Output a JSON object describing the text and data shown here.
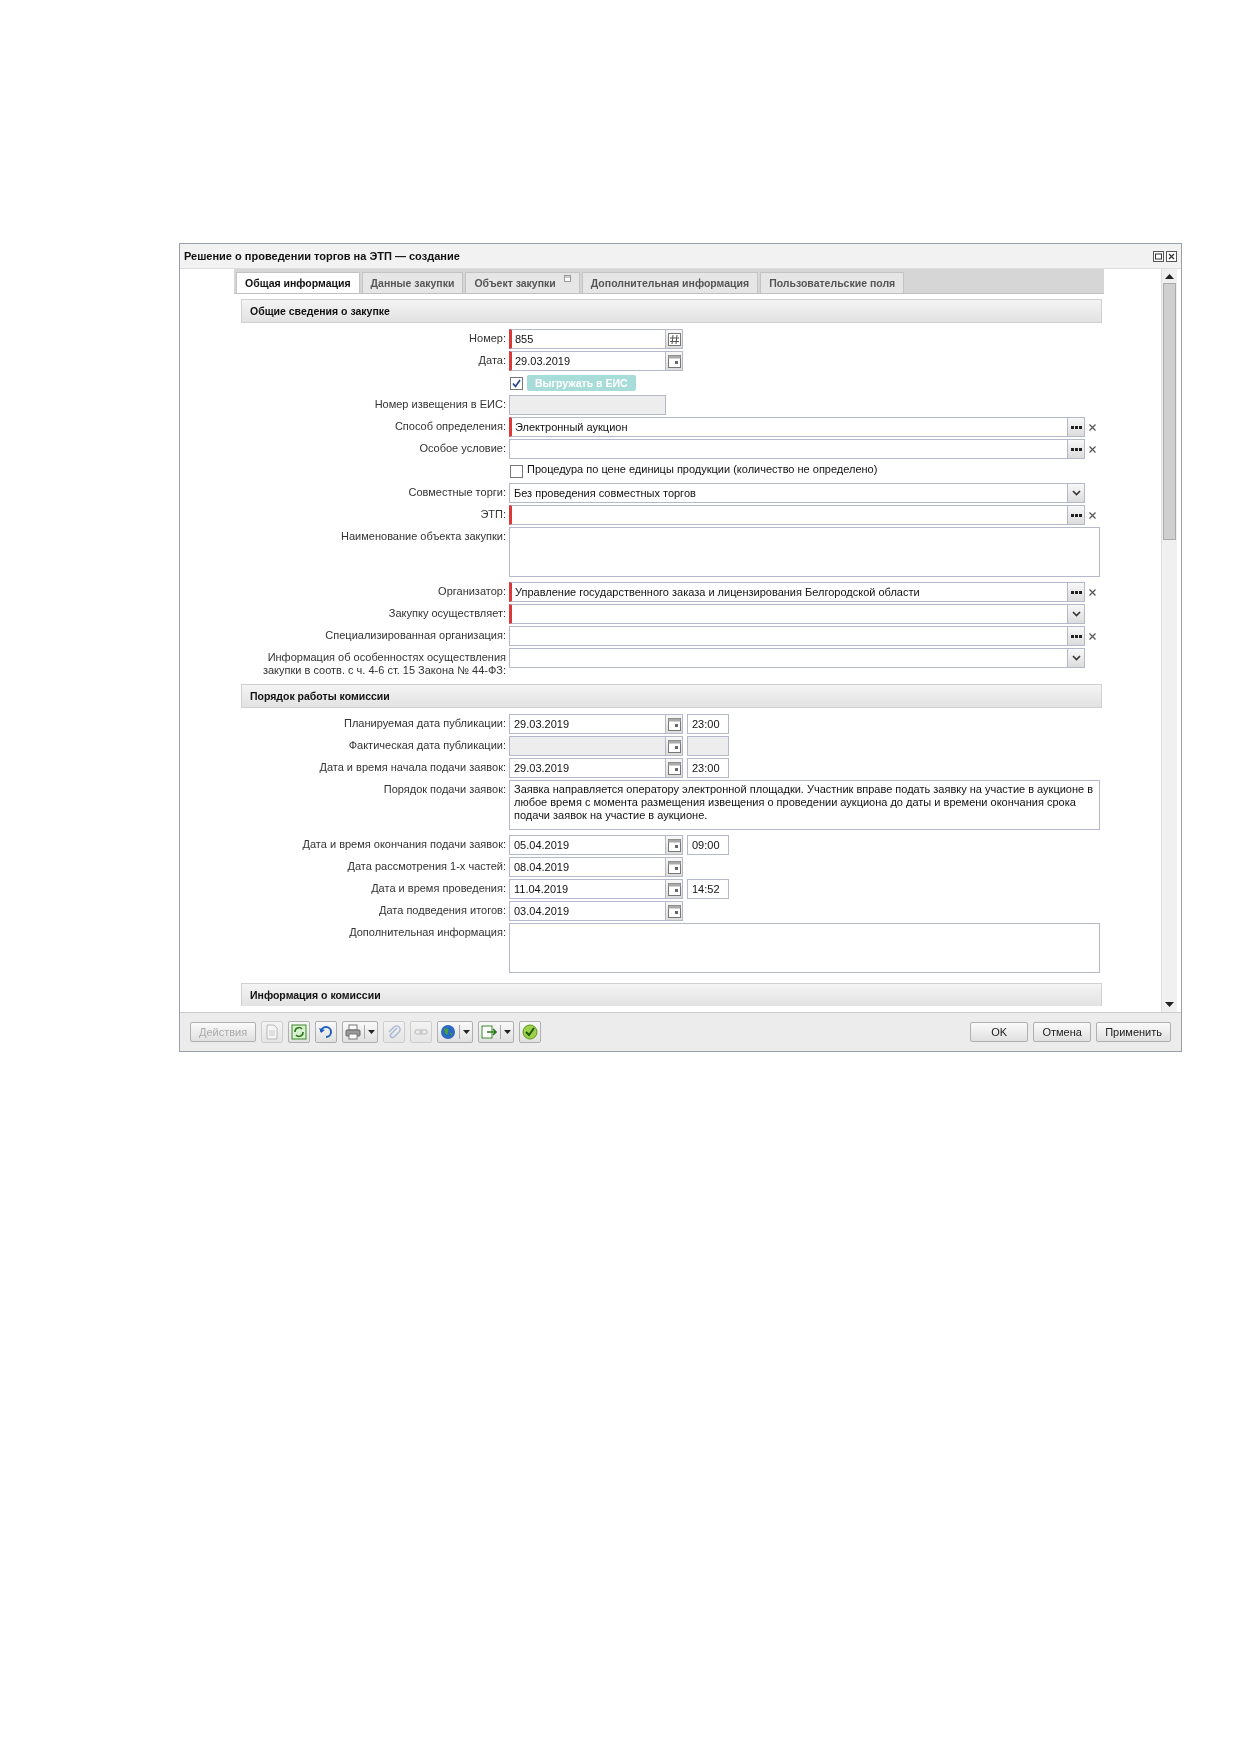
{
  "window": {
    "title": "Решение о проведении торгов на ЭТП — создание"
  },
  "tabs": [
    {
      "label": "Общая информация",
      "selected": true,
      "has_icon": false
    },
    {
      "label": "Данные закупки",
      "selected": false,
      "has_icon": false
    },
    {
      "label": "Объект закупки",
      "selected": false,
      "has_icon": true
    },
    {
      "label": "Дополнительная информация",
      "selected": false,
      "has_icon": false
    },
    {
      "label": "Пользовательские поля",
      "selected": false,
      "has_icon": false
    }
  ],
  "sections": [
    {
      "title": "Общие сведения о закупке",
      "rows": [
        {
          "kind": "number",
          "label": "Номер:",
          "value": "855",
          "required": true,
          "disabled": false
        },
        {
          "kind": "date",
          "label": "Дата:",
          "value": "29.03.2019",
          "required": true,
          "disabled": false
        },
        {
          "kind": "checkbox_button",
          "checked": true,
          "button": "Выгружать в ЕИС"
        },
        {
          "kind": "text",
          "label": "Номер извещения в ЕИС:",
          "required": false,
          "disabled": true
        },
        {
          "kind": "lookup",
          "label": "Способ определения:",
          "value": "Электронный аукцион",
          "required": true,
          "disabled": false
        },
        {
          "kind": "lookup",
          "label": "Особое условие:",
          "required": false,
          "disabled": false
        },
        {
          "kind": "checkbox",
          "checked": false,
          "text": "Процедура по цене единицы продукции (количество не определено)"
        },
        {
          "kind": "select",
          "label": "Совместные торги:",
          "value": "Без проведения совместных торгов",
          "required": false,
          "disabled": false
        },
        {
          "kind": "lookup",
          "label": "ЭТП:",
          "required": true,
          "disabled": false
        },
        {
          "kind": "textarea",
          "label": "Наименование объекта закупки:",
          "required": false,
          "disabled": false
        },
        {
          "kind": "lookup",
          "label": "Организатор:",
          "value": "Управление государственного заказа и лицензирования Белгородской области",
          "required": true,
          "disabled": false
        },
        {
          "kind": "select",
          "label": "Закупку осуществляет:",
          "required": true,
          "disabled": false
        },
        {
          "kind": "lookup",
          "label": "Специализированная организация:",
          "required": false,
          "disabled": false
        },
        {
          "kind": "select",
          "label": "Информация об особенностях осуществления закупки в соотв. с ч. 4-6 ст. 15 Закона № 44-ФЗ:",
          "required": false,
          "disabled": false
        }
      ]
    },
    {
      "title": "Порядок работы комиссии",
      "rows": [
        {
          "kind": "datetime",
          "label": "Планируемая дата публикации:",
          "value": "29.03.2019",
          "time": "23:00",
          "required": false,
          "disabled": false
        },
        {
          "kind": "datetime",
          "label": "Фактическая дата публикации:",
          "required": false,
          "disabled": true
        },
        {
          "kind": "datetime",
          "label": "Дата и время начала подачи заявок:",
          "value": "29.03.2019",
          "time": "23:00",
          "required": false,
          "disabled": false
        },
        {
          "kind": "textarea",
          "label": "Порядок подачи заявок:",
          "value": "Заявка направляется оператору электронной площадки. Участник вправе подать заявку на участие в аукционе в любое время с момента размещения извещения о проведении аукциона до даты и времени окончания срока подачи заявок на участие в аукционе.",
          "required": false,
          "disabled": false
        },
        {
          "kind": "datetime",
          "label": "Дата и время окончания подачи заявок:",
          "value": "05.04.2019",
          "time": "09:00",
          "required": false,
          "disabled": false
        },
        {
          "kind": "date",
          "label": "Дата рассмотрения 1-х частей:",
          "value": "08.04.2019",
          "required": false,
          "disabled": false
        },
        {
          "kind": "datetime",
          "label": "Дата и время проведения:",
          "value": "11.04.2019",
          "time": "14:52",
          "required": false,
          "disabled": false
        },
        {
          "kind": "date",
          "label": "Дата подведения итогов:",
          "value": "03.04.2019",
          "required": false,
          "disabled": false
        },
        {
          "kind": "textarea",
          "label": "Дополнительная информация:",
          "required": false,
          "disabled": false
        }
      ]
    },
    {
      "title": "Информация о комиссии"
    }
  ],
  "toolbar": {
    "actions": {
      "label": "Действия",
      "disabled": true
    },
    "tools": [
      {
        "kind": "document",
        "disabled": true
      },
      {
        "kind": "refresh",
        "disabled": false
      },
      {
        "kind": "undo",
        "disabled": false
      },
      {
        "kind": "print",
        "disabled": false,
        "menu": true
      },
      {
        "kind": "attach",
        "disabled": true
      },
      {
        "kind": "link",
        "disabled": true
      },
      {
        "kind": "globe",
        "disabled": false,
        "menu": true
      },
      {
        "kind": "export",
        "disabled": false,
        "menu": true
      },
      {
        "kind": "approve",
        "disabled": false
      }
    ],
    "buttons": [
      "OK",
      "Отмена",
      "Применить"
    ]
  }
}
